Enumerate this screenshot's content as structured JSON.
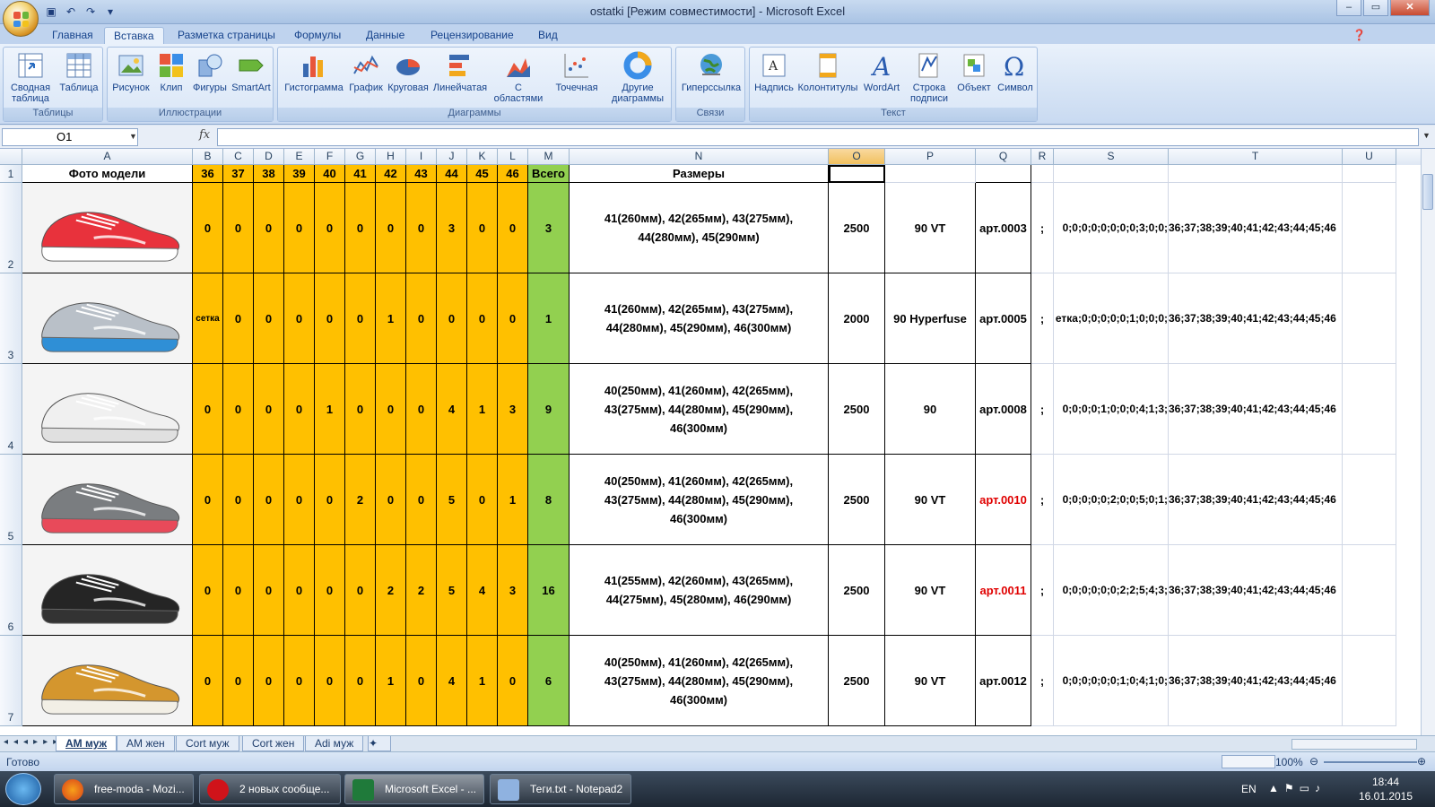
{
  "window": {
    "title": "ostatki  [Режим совместимости] - Microsoft Excel"
  },
  "ribbon_tabs": [
    "Главная",
    "Вставка",
    "Разметка страницы",
    "Формулы",
    "Данные",
    "Рецензирование",
    "Вид"
  ],
  "ribbon_groups": {
    "tables": {
      "label": "Таблицы",
      "buttons": [
        "Сводная таблица",
        "Таблица"
      ]
    },
    "illustrations": {
      "label": "Иллюстрации",
      "buttons": [
        "Рисунок",
        "Клип",
        "Фигуры",
        "SmartArt"
      ]
    },
    "charts": {
      "label": "Диаграммы",
      "buttons": [
        "Гистограмма",
        "График",
        "Круговая",
        "Линейчатая",
        "С областями",
        "Точечная",
        "Другие диаграммы"
      ]
    },
    "links": {
      "label": "Связи",
      "buttons": [
        "Гиперссылка"
      ]
    },
    "text": {
      "label": "Текст",
      "buttons": [
        "Надпись",
        "Колонтитулы",
        "WordArt",
        "Строка подписи",
        "Объект",
        "Символ"
      ]
    }
  },
  "namebox": "O1",
  "fx": "fx",
  "columns": [
    "A",
    "B",
    "C",
    "D",
    "E",
    "F",
    "G",
    "H",
    "I",
    "J",
    "K",
    "L",
    "M",
    "N",
    "O",
    "P",
    "Q",
    "R",
    "S",
    "T",
    "U"
  ],
  "header_row": {
    "A": "Фото модели",
    "sizes": [
      "36",
      "37",
      "38",
      "39",
      "40",
      "41",
      "42",
      "43",
      "44",
      "45",
      "46"
    ],
    "M": "Всего",
    "N": "Размеры"
  },
  "rows": [
    {
      "num": "2",
      "vals": [
        "0",
        "0",
        "0",
        "0",
        "0",
        "0",
        "0",
        "0",
        "3",
        "0",
        "0"
      ],
      "total": "3",
      "sizes_text": "41(260мм), 42(265мм), 43(275мм), 44(280мм), 45(290мм)",
      "price": "2500",
      "model": "90 VT",
      "art": "арт.0003",
      "art_red": false,
      "r": ";",
      "s": "0;0;0;0;0;0;0;0;3;0;0;",
      "t": "36;37;38;39;40;41;42;43;44;45;46",
      "shoe_color": "#e8323c",
      "sole": "#ffffff"
    },
    {
      "num": "3",
      "vals": [
        "сетка",
        "0",
        "0",
        "0",
        "0",
        "0",
        "1",
        "0",
        "0",
        "0",
        "0"
      ],
      "total": "1",
      "sizes_text": "41(260мм), 42(265мм), 43(275мм), 44(280мм), 45(290мм), 46(300мм)",
      "price": "2000",
      "model": "90 Hyperfuse",
      "art": "арт.0005",
      "art_red": false,
      "r": ";",
      "s": "етка;0;0;0;0;0;1;0;0;0;",
      "t": "36;37;38;39;40;41;42;43;44;45;46",
      "shoe_color": "#b9c0c8",
      "sole": "#2f8fd6"
    },
    {
      "num": "4",
      "vals": [
        "0",
        "0",
        "0",
        "0",
        "1",
        "0",
        "0",
        "0",
        "4",
        "1",
        "3"
      ],
      "total": "9",
      "sizes_text": "40(250мм), 41(260мм), 42(265мм), 43(275мм), 44(280мм), 45(290мм), 46(300мм)",
      "price": "2500",
      "model": "90",
      "art": "арт.0008",
      "art_red": false,
      "r": ";",
      "s": "0;0;0;0;1;0;0;0;4;1;3;",
      "t": "36;37;38;39;40;41;42;43;44;45;46",
      "shoe_color": "#f0f0f0",
      "sole": "#e0e0e0"
    },
    {
      "num": "5",
      "vals": [
        "0",
        "0",
        "0",
        "0",
        "0",
        "2",
        "0",
        "0",
        "5",
        "0",
        "1"
      ],
      "total": "8",
      "sizes_text": "40(250мм), 41(260мм), 42(265мм), 43(275мм), 44(280мм), 45(290мм), 46(300мм)",
      "price": "2500",
      "model": "90 VT",
      "art": "арт.0010",
      "art_red": true,
      "r": ";",
      "s": "0;0;0;0;0;2;0;0;5;0;1;",
      "t": "36;37;38;39;40;41;42;43;44;45;46",
      "shoe_color": "#7a7d80",
      "sole": "#e84a5a"
    },
    {
      "num": "6",
      "vals": [
        "0",
        "0",
        "0",
        "0",
        "0",
        "0",
        "2",
        "2",
        "5",
        "4",
        "3"
      ],
      "total": "16",
      "sizes_text": "41(255мм), 42(260мм), 43(265мм), 44(275мм), 45(280мм), 46(290мм)",
      "price": "2500",
      "model": "90 VT",
      "art": "арт.0011",
      "art_red": true,
      "r": ";",
      "s": "0;0;0;0;0;0;2;2;5;4;3;",
      "t": "36;37;38;39;40;41;42;43;44;45;46",
      "shoe_color": "#252525",
      "sole": "#333333"
    },
    {
      "num": "7",
      "vals": [
        "0",
        "0",
        "0",
        "0",
        "0",
        "0",
        "1",
        "0",
        "4",
        "1",
        "0"
      ],
      "total": "6",
      "sizes_text": "40(250мм), 41(260мм), 42(265мм), 43(275мм), 44(280мм), 45(290мм), 46(300мм)",
      "price": "2500",
      "model": "90 VT",
      "art": "арт.0012",
      "art_red": false,
      "r": ";",
      "s": "0;0;0;0;0;0;1;0;4;1;0;",
      "t": "36;37;38;39;40;41;42;43;44;45;46",
      "shoe_color": "#d4962e",
      "sole": "#f2efe6"
    }
  ],
  "sheet_tabs": [
    "AM муж",
    "AM жен",
    "Cort муж",
    "Cort жен",
    "Adi муж"
  ],
  "status": {
    "ready": "Готово",
    "zoom": "100%"
  },
  "taskbar": {
    "items": [
      "free-moda - Mozi...",
      "2 новых сообще...",
      "Microsoft Excel - ...",
      "Теги.txt - Notepad2"
    ],
    "lang": "EN",
    "time": "18:44",
    "date": "16.01.2015"
  }
}
